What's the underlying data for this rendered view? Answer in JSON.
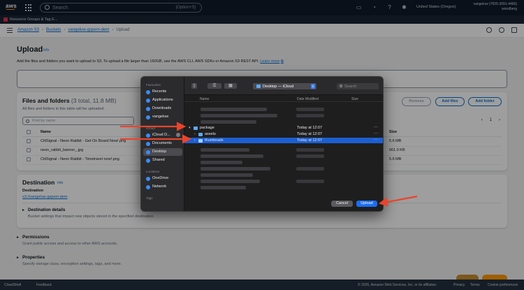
{
  "topnav": {
    "logo": "aws",
    "search_placeholder": "Search",
    "search_shortcut": "[Option+S]",
    "region": "United States (Oregon)",
    "account_line1": "vangeluw (7655-3091-4466)",
    "account_line2": "woodberg"
  },
  "favbar": {
    "label": "Resource Groups & Tag E..."
  },
  "breadcrumbs": [
    "Amazon S3",
    "Buckets",
    "vangeluw-gspem-dem",
    "Upload"
  ],
  "page": {
    "title": "Upload",
    "info": "Info",
    "description": "Add the files and folders you want to upload to S3. To upload a file larger than 160GB, use the AWS CLI, AWS SDKs or Amazon S3 REST API.",
    "learn_more": "Learn more"
  },
  "files": {
    "title": "Files and folders",
    "count": "(3 total, 11.8 MB)",
    "subtitle": "All files and folders in this table will be uploaded.",
    "buttons": {
      "remove": "Remove",
      "add_files": "Add files",
      "add_folder": "Add folder"
    },
    "find_placeholder": "Find by name",
    "page_number": "1",
    "columns": {
      "name": "Name",
      "size": "Size"
    },
    "rows": [
      {
        "name": "CitiSignal - Neon Rabbit - Get On Board Now!.png",
        "size": "5.6 MB"
      },
      {
        "name": "neon_rabbit_banner_.jpg",
        "size": "661.0 KB"
      },
      {
        "name": "CitiSignal - Neon Rabbit - Timetravel now!.png",
        "size": "5.6 MB"
      }
    ]
  },
  "destination": {
    "title": "Destination",
    "info": "Info",
    "label": "Destination",
    "link": "s3://vangeluw-gspem-dem",
    "details_title": "Destination details",
    "details_desc": "Bucket settings that impact new objects stored in the specified destination."
  },
  "permissions": {
    "title": "Permissions",
    "desc": "Grant public access and access to other AWS accounts."
  },
  "properties": {
    "title": "Properties",
    "desc": "Specify storage class, encryption settings, tags, and more."
  },
  "footer": {
    "cloudshell": "CloudShell",
    "feedback": "Feedback",
    "copyright": "© 2025, Amazon Web Services, Inc. or its affiliates.",
    "privacy": "Privacy",
    "terms": "Terms",
    "cookie": "Cookie preferences"
  },
  "dialog": {
    "sidebar": {
      "favourites_head": "Favourites",
      "favourites": [
        "Recents",
        "Applications",
        "Downloads",
        "vangeluw"
      ],
      "icloud_head": "iCloud",
      "icloud": [
        "iCloud D...",
        "Documents",
        "Desktop",
        "Shared"
      ],
      "locations_head": "Locations",
      "locations": [
        "OneDrive",
        "Network"
      ],
      "tags_head": "Tags"
    },
    "location": "Desktop — iCloud",
    "search_placeholder": "Search",
    "columns": {
      "name": "Name",
      "date": "Date Modified",
      "size": "Size"
    },
    "rows": [
      {
        "name": "package",
        "date": "Today at 12:07",
        "expanded": true
      },
      {
        "name": "assets",
        "date": "Today at 12:07",
        "expanded": false
      },
      {
        "name": "thumbnails",
        "date": "Today at 12:07",
        "expanded": false,
        "selected": true
      }
    ],
    "more": "···",
    "cancel": "Cancel",
    "upload": "Upload"
  },
  "colors": {
    "accent": "#0972d3",
    "aws_orange": "#ff9900",
    "arrow": "#e8452c",
    "selection": "#1c5fd1"
  }
}
